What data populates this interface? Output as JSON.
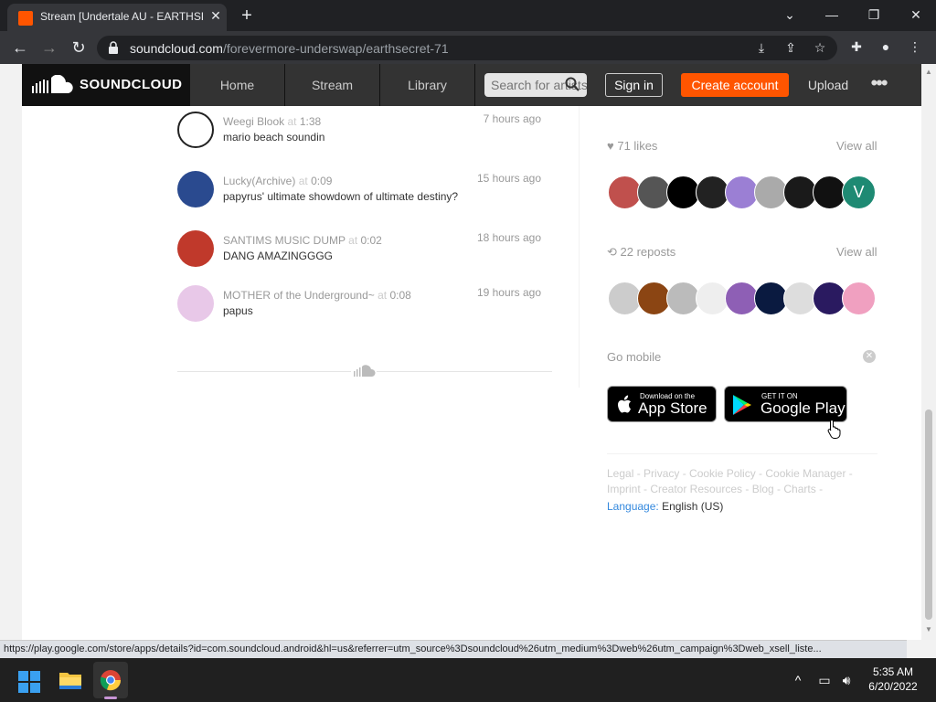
{
  "browser": {
    "tab_title": "Stream [Undertale AU - EARTHSECRET",
    "tab_close": "✕",
    "new_tab": "+",
    "url_host": "soundcloud.com",
    "url_path": "/forevermore-underswap/earthsecret-71",
    "window_controls": [
      "⌄",
      "—",
      "❐",
      "✕"
    ]
  },
  "header": {
    "logo_text": "SOUNDCLOUD",
    "nav": [
      "Home",
      "Stream",
      "Library"
    ],
    "search_placeholder": "Search for artists",
    "sign_in": "Sign in",
    "create_account": "Create account",
    "upload": "Upload",
    "more": "•••"
  },
  "comments": [
    {
      "user": "Weegi Blook",
      "at": "at",
      "time": "1:38",
      "text": "mario beach soundin",
      "ago": "7 hours ago",
      "avatar_color": "#ffffff"
    },
    {
      "user": "Lucky(Archive)",
      "at": "at",
      "time": "0:09",
      "text": "papyrus' ultimate showdown of ultimate destiny?",
      "ago": "15 hours ago",
      "avatar_color": "#2a4a8f"
    },
    {
      "user": "SANTIMS MUSIC DUMP",
      "at": "at",
      "time": "0:02",
      "text": "DANG AMAZINGGGG",
      "ago": "18 hours ago",
      "avatar_color": "#c0392b"
    },
    {
      "user": "MOTHER of the Underground~",
      "at": "at",
      "time": "0:08",
      "text": "papus",
      "ago": "19 hours ago",
      "avatar_color": "#e8c8e8"
    }
  ],
  "sidebar": {
    "likes": "71 likes",
    "reposts": "22 reposts",
    "view_all": "View all",
    "like_avatar_colors": [
      "#c0504d",
      "#555555",
      "#000000",
      "#222222",
      "#9b7fd4",
      "#aaaaaa",
      "#1a1a1a",
      "#111111",
      "#1e8a73"
    ],
    "like_v_letter": "V",
    "repost_avatar_colors": [
      "#cccccc",
      "#8b4513",
      "#bbbbbb",
      "#eeeeee",
      "#8e5fb5",
      "#0a1a40",
      "#dddddd",
      "#2a1a60",
      "#f0a0c0"
    ],
    "go_mobile": "Go mobile",
    "app_store_small": "Download on the",
    "app_store_big": "App Store",
    "google_play_small": "GET IT ON",
    "google_play_big": "Google Play",
    "footer_links": "Legal - Privacy - Cookie Policy - Cookie Manager - Imprint - Creator Resources - Blog - Charts -",
    "language_label": "Language:",
    "language_value": "English (US)"
  },
  "status_url": "https://play.google.com/store/apps/details?id=com.soundcloud.android&hl=us&referrer=utm_source%3Dsoundcloud%26utm_medium%3Dweb%26utm_campaign%3Dweb_xsell_liste...",
  "taskbar": {
    "time": "5:35 AM",
    "date": "6/20/2022"
  }
}
